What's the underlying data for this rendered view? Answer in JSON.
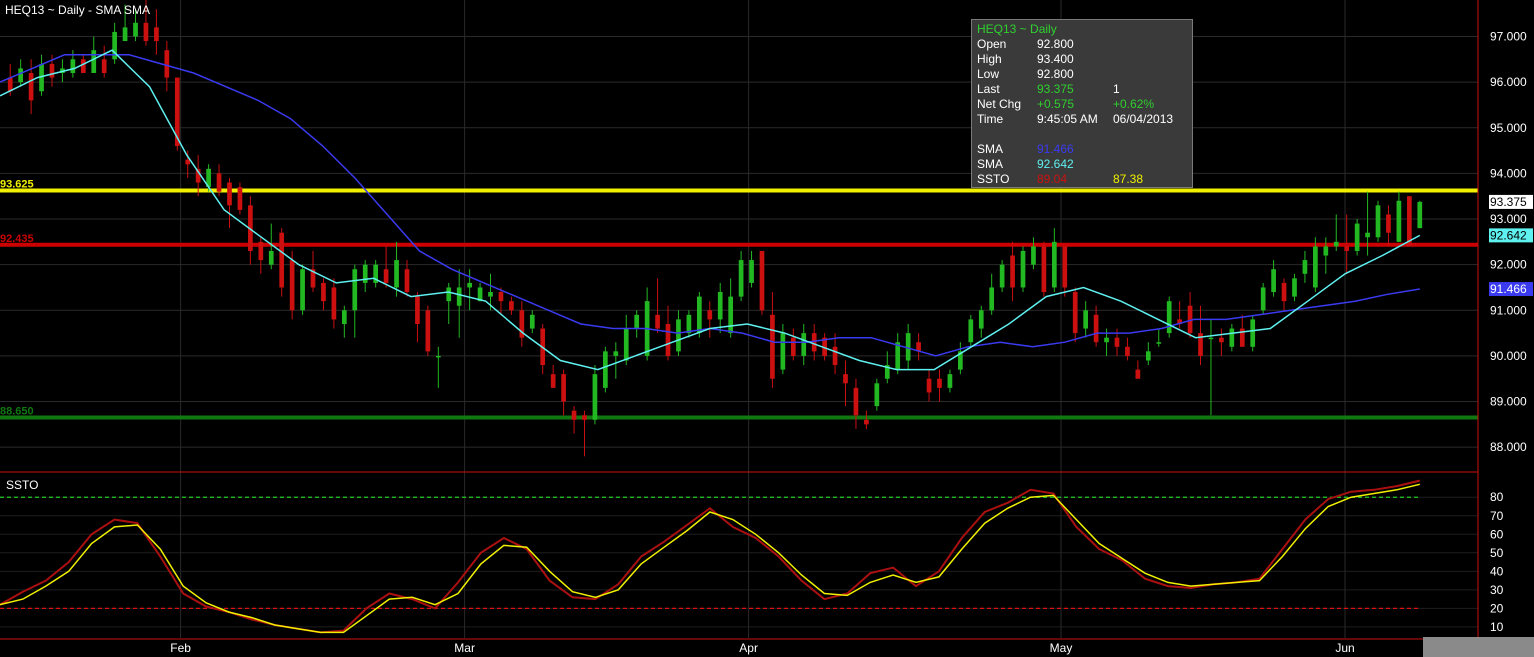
{
  "header": {
    "title": "HEQ13 ~ Daily  -  SMA SMA"
  },
  "info_panel": {
    "title": "HEQ13 ~ Daily",
    "rows": [
      {
        "label": "Open",
        "v1": "92.800",
        "v2": "",
        "c1": "#ffffff",
        "c2": "#ffffff"
      },
      {
        "label": "High",
        "v1": "93.400",
        "v2": "",
        "c1": "#ffffff",
        "c2": "#ffffff"
      },
      {
        "label": "Low",
        "v1": "92.800",
        "v2": "",
        "c1": "#ffffff",
        "c2": "#ffffff"
      },
      {
        "label": "Last",
        "v1": "93.375",
        "v2": "1",
        "c1": "#2fd02f",
        "c2": "#ffffff"
      },
      {
        "label": "Net Chg",
        "v1": "+0.575",
        "v2": "+0.62%",
        "c1": "#2fd02f",
        "c2": "#2fd02f"
      },
      {
        "label": "Time",
        "v1": "9:45:05 AM",
        "v2": "06/04/2013",
        "c1": "#ffffff",
        "c2": "#ffffff"
      },
      {
        "label": "",
        "v1": "",
        "v2": "",
        "c1": "#ffffff",
        "c2": "#ffffff"
      },
      {
        "label": "SMA",
        "v1": "91.466",
        "v2": "",
        "c1": "#3a3af0",
        "c2": "#ffffff"
      },
      {
        "label": "SMA",
        "v1": "92.642",
        "v2": "",
        "c1": "#5ff0f0",
        "c2": "#ffffff"
      },
      {
        "label": "SSTO",
        "v1": "89.04",
        "v2": "87.38",
        "c1": "#d01010",
        "c2": "#f0f000"
      }
    ]
  },
  "colors": {
    "up": "#22b822",
    "down": "#cc1010",
    "sma_slow": "#3a3af0",
    "sma_fast": "#5ff0f0",
    "ssto_k": "#aa1010",
    "ssto_d": "#f0f000"
  },
  "chart_data": {
    "type": "candlestick",
    "x_tick_labels": [
      "Feb",
      "Mar",
      "Apr",
      "May",
      "Jun"
    ],
    "x_tick_positions": [
      12,
      32,
      52,
      74,
      94
    ],
    "price_axis": {
      "ticks": [
        "88.000",
        "89.000",
        "90.000",
        "91.000",
        "92.000",
        "93.000",
        "94.000",
        "95.000",
        "96.000",
        "97.000"
      ],
      "range": [
        87.5,
        97.8
      ]
    },
    "ssto_axis": {
      "title": "SSTO",
      "ticks": [
        "10",
        "20",
        "30",
        "40",
        "50",
        "60",
        "70",
        "80"
      ],
      "range": [
        4,
        92
      ],
      "overbought": 80,
      "oversold": 20
    },
    "horizontal_lines": [
      {
        "value": 93.625,
        "label": "93.625",
        "color": "#f0f000"
      },
      {
        "value": 92.435,
        "label": "92.435",
        "color": "#cc0000"
      },
      {
        "value": 88.65,
        "label": "88.650",
        "color": "#117711"
      }
    ],
    "right_labels": [
      {
        "value": 93.375,
        "label": "93.375",
        "bg": "#ffffff",
        "fg": "#000000"
      },
      {
        "value": 92.642,
        "label": "92.642",
        "bg": "#5ff0f0",
        "fg": "#000000"
      },
      {
        "value": 91.466,
        "label": "91.466",
        "bg": "#3a3af0",
        "fg": "#ffffff"
      }
    ],
    "candles": [
      {
        "o": 96.1,
        "h": 96.4,
        "l": 95.7,
        "c": 95.8
      },
      {
        "o": 96.0,
        "h": 96.5,
        "l": 95.9,
        "c": 96.3
      },
      {
        "o": 96.2,
        "h": 96.5,
        "l": 95.3,
        "c": 95.6
      },
      {
        "o": 95.8,
        "h": 96.6,
        "l": 95.7,
        "c": 96.4
      },
      {
        "o": 96.4,
        "h": 96.6,
        "l": 95.9,
        "c": 96.1
      },
      {
        "o": 96.2,
        "h": 96.5,
        "l": 96.0,
        "c": 96.3
      },
      {
        "o": 96.2,
        "h": 96.7,
        "l": 96.1,
        "c": 96.5
      },
      {
        "o": 96.5,
        "h": 96.6,
        "l": 96.2,
        "c": 96.2
      },
      {
        "o": 96.2,
        "h": 97.0,
        "l": 96.2,
        "c": 96.7
      },
      {
        "o": 96.5,
        "h": 96.8,
        "l": 96.1,
        "c": 96.2
      },
      {
        "o": 96.5,
        "h": 97.3,
        "l": 96.4,
        "c": 97.1
      },
      {
        "o": 96.9,
        "h": 97.7,
        "l": 96.9,
        "c": 97.2
      },
      {
        "o": 97.0,
        "h": 97.6,
        "l": 96.9,
        "c": 97.3
      },
      {
        "o": 97.3,
        "h": 97.8,
        "l": 96.8,
        "c": 96.9
      },
      {
        "o": 97.2,
        "h": 97.6,
        "l": 96.6,
        "c": 96.9
      },
      {
        "o": 96.7,
        "h": 96.9,
        "l": 95.8,
        "c": 96.1
      },
      {
        "o": 96.1,
        "h": 96.1,
        "l": 94.5,
        "c": 94.6
      },
      {
        "o": 94.3,
        "h": 94.5,
        "l": 93.9,
        "c": 94.2
      },
      {
        "o": 94.1,
        "h": 94.4,
        "l": 93.5,
        "c": 93.8
      },
      {
        "o": 93.7,
        "h": 94.2,
        "l": 93.6,
        "c": 94.1
      },
      {
        "o": 94.0,
        "h": 94.2,
        "l": 93.5,
        "c": 93.6
      },
      {
        "o": 93.8,
        "h": 93.9,
        "l": 92.8,
        "c": 93.3
      },
      {
        "o": 93.7,
        "h": 93.8,
        "l": 93.1,
        "c": 93.2
      },
      {
        "o": 93.3,
        "h": 93.5,
        "l": 92.0,
        "c": 92.3
      },
      {
        "o": 92.5,
        "h": 92.6,
        "l": 91.8,
        "c": 92.1
      },
      {
        "o": 92.0,
        "h": 92.9,
        "l": 91.9,
        "c": 92.3
      },
      {
        "o": 92.7,
        "h": 92.8,
        "l": 91.3,
        "c": 91.5
      },
      {
        "o": 92.1,
        "h": 92.3,
        "l": 90.8,
        "c": 91.0
      },
      {
        "o": 91.0,
        "h": 92.0,
        "l": 90.9,
        "c": 91.9
      },
      {
        "o": 91.9,
        "h": 92.3,
        "l": 91.4,
        "c": 91.5
      },
      {
        "o": 91.6,
        "h": 91.7,
        "l": 91.0,
        "c": 91.2
      },
      {
        "o": 91.5,
        "h": 91.7,
        "l": 90.6,
        "c": 90.8
      },
      {
        "o": 90.7,
        "h": 91.1,
        "l": 90.4,
        "c": 91.0
      },
      {
        "o": 91.0,
        "h": 92.0,
        "l": 90.4,
        "c": 91.9
      },
      {
        "o": 91.6,
        "h": 92.1,
        "l": 91.4,
        "c": 92.0
      },
      {
        "o": 91.6,
        "h": 92.1,
        "l": 91.5,
        "c": 92.0
      },
      {
        "o": 91.9,
        "h": 92.4,
        "l": 91.5,
        "c": 91.6
      },
      {
        "o": 91.5,
        "h": 92.5,
        "l": 91.3,
        "c": 92.1
      },
      {
        "o": 91.9,
        "h": 92.1,
        "l": 91.3,
        "c": 91.4
      },
      {
        "o": 91.3,
        "h": 91.4,
        "l": 90.3,
        "c": 90.7
      },
      {
        "o": 91.0,
        "h": 91.1,
        "l": 90.0,
        "c": 90.1
      },
      {
        "o": 90.0,
        "h": 90.2,
        "l": 89.3,
        "c": 90.0
      },
      {
        "o": 91.2,
        "h": 91.6,
        "l": 90.7,
        "c": 91.5
      },
      {
        "o": 91.1,
        "h": 91.9,
        "l": 90.4,
        "c": 91.5
      },
      {
        "o": 91.5,
        "h": 91.9,
        "l": 91.0,
        "c": 91.6
      },
      {
        "o": 91.2,
        "h": 91.6,
        "l": 91.2,
        "c": 91.5
      },
      {
        "o": 91.3,
        "h": 91.8,
        "l": 91.0,
        "c": 91.4
      },
      {
        "o": 91.4,
        "h": 91.5,
        "l": 90.9,
        "c": 91.2
      },
      {
        "o": 91.2,
        "h": 91.3,
        "l": 90.9,
        "c": 91.0
      },
      {
        "o": 91.0,
        "h": 91.2,
        "l": 90.2,
        "c": 90.4
      },
      {
        "o": 90.6,
        "h": 91.0,
        "l": 90.5,
        "c": 90.9
      },
      {
        "o": 90.6,
        "h": 90.7,
        "l": 89.6,
        "c": 89.8
      },
      {
        "o": 89.6,
        "h": 89.8,
        "l": 89.3,
        "c": 89.3
      },
      {
        "o": 89.6,
        "h": 89.7,
        "l": 88.7,
        "c": 89.0
      },
      {
        "o": 88.8,
        "h": 88.9,
        "l": 88.3,
        "c": 88.6
      },
      {
        "o": 88.7,
        "h": 88.8,
        "l": 87.8,
        "c": 88.6
      },
      {
        "o": 88.6,
        "h": 89.8,
        "l": 88.5,
        "c": 89.6
      },
      {
        "o": 89.3,
        "h": 90.2,
        "l": 89.2,
        "c": 90.1
      },
      {
        "o": 90.0,
        "h": 90.3,
        "l": 89.5,
        "c": 90.1
      },
      {
        "o": 89.9,
        "h": 90.9,
        "l": 89.8,
        "c": 90.6
      },
      {
        "o": 90.6,
        "h": 91.0,
        "l": 90.4,
        "c": 90.9
      },
      {
        "o": 90.0,
        "h": 91.5,
        "l": 89.9,
        "c": 91.2
      },
      {
        "o": 90.9,
        "h": 91.7,
        "l": 90.5,
        "c": 90.6
      },
      {
        "o": 90.7,
        "h": 91.1,
        "l": 89.9,
        "c": 90.0
      },
      {
        "o": 90.1,
        "h": 91.0,
        "l": 90.0,
        "c": 90.8
      },
      {
        "o": 90.5,
        "h": 91.0,
        "l": 90.4,
        "c": 90.9
      },
      {
        "o": 90.5,
        "h": 91.4,
        "l": 90.4,
        "c": 91.3
      },
      {
        "o": 91.0,
        "h": 91.2,
        "l": 90.4,
        "c": 90.8
      },
      {
        "o": 90.8,
        "h": 91.6,
        "l": 90.5,
        "c": 91.4
      },
      {
        "o": 90.5,
        "h": 91.7,
        "l": 90.4,
        "c": 91.3
      },
      {
        "o": 91.3,
        "h": 92.3,
        "l": 91.2,
        "c": 92.1
      },
      {
        "o": 91.6,
        "h": 92.3,
        "l": 91.5,
        "c": 92.1
      },
      {
        "o": 92.3,
        "h": 92.3,
        "l": 90.9,
        "c": 91.0
      },
      {
        "o": 90.9,
        "h": 91.4,
        "l": 89.3,
        "c": 89.5
      },
      {
        "o": 89.7,
        "h": 90.7,
        "l": 89.6,
        "c": 90.5
      },
      {
        "o": 90.4,
        "h": 90.6,
        "l": 89.9,
        "c": 90.0
      },
      {
        "o": 90.0,
        "h": 90.7,
        "l": 89.8,
        "c": 90.5
      },
      {
        "o": 90.5,
        "h": 90.7,
        "l": 89.9,
        "c": 90.1
      },
      {
        "o": 90.4,
        "h": 90.5,
        "l": 89.9,
        "c": 90.0
      },
      {
        "o": 90.2,
        "h": 90.5,
        "l": 89.6,
        "c": 89.8
      },
      {
        "o": 89.6,
        "h": 89.9,
        "l": 88.9,
        "c": 89.4
      },
      {
        "o": 89.3,
        "h": 89.5,
        "l": 88.4,
        "c": 88.7
      },
      {
        "o": 88.6,
        "h": 88.8,
        "l": 88.4,
        "c": 88.5
      },
      {
        "o": 88.9,
        "h": 89.5,
        "l": 88.8,
        "c": 89.4
      },
      {
        "o": 89.5,
        "h": 90.1,
        "l": 89.4,
        "c": 89.8
      },
      {
        "o": 89.7,
        "h": 90.5,
        "l": 89.6,
        "c": 90.3
      },
      {
        "o": 89.9,
        "h": 90.7,
        "l": 89.7,
        "c": 90.5
      },
      {
        "o": 90.3,
        "h": 90.5,
        "l": 89.9,
        "c": 90.1
      },
      {
        "o": 89.5,
        "h": 89.7,
        "l": 89.0,
        "c": 89.2
      },
      {
        "o": 89.5,
        "h": 89.7,
        "l": 89.0,
        "c": 89.3
      },
      {
        "o": 89.3,
        "h": 89.7,
        "l": 89.2,
        "c": 89.6
      },
      {
        "o": 89.7,
        "h": 90.3,
        "l": 89.6,
        "c": 90.1
      },
      {
        "o": 90.3,
        "h": 90.9,
        "l": 90.2,
        "c": 90.8
      },
      {
        "o": 90.6,
        "h": 91.1,
        "l": 90.4,
        "c": 91.0
      },
      {
        "o": 91.0,
        "h": 91.8,
        "l": 90.9,
        "c": 91.5
      },
      {
        "o": 91.5,
        "h": 92.1,
        "l": 91.4,
        "c": 92.0
      },
      {
        "o": 92.2,
        "h": 92.5,
        "l": 91.2,
        "c": 91.5
      },
      {
        "o": 91.5,
        "h": 92.4,
        "l": 91.4,
        "c": 92.3
      },
      {
        "o": 92.0,
        "h": 92.6,
        "l": 91.9,
        "c": 92.4
      },
      {
        "o": 92.4,
        "h": 92.5,
        "l": 91.3,
        "c": 91.4
      },
      {
        "o": 91.5,
        "h": 92.8,
        "l": 91.4,
        "c": 92.5
      },
      {
        "o": 92.4,
        "h": 92.4,
        "l": 91.3,
        "c": 91.5
      },
      {
        "o": 91.4,
        "h": 91.5,
        "l": 90.3,
        "c": 90.5
      },
      {
        "o": 90.6,
        "h": 91.2,
        "l": 90.4,
        "c": 91.0
      },
      {
        "o": 90.9,
        "h": 91.1,
        "l": 90.2,
        "c": 90.3
      },
      {
        "o": 90.3,
        "h": 90.6,
        "l": 90.0,
        "c": 90.4
      },
      {
        "o": 90.4,
        "h": 90.6,
        "l": 90.0,
        "c": 90.2
      },
      {
        "o": 90.2,
        "h": 90.4,
        "l": 89.9,
        "c": 90.0
      },
      {
        "o": 89.7,
        "h": 89.9,
        "l": 89.5,
        "c": 89.5
      },
      {
        "o": 89.9,
        "h": 90.3,
        "l": 89.8,
        "c": 90.1
      },
      {
        "o": 90.3,
        "h": 90.6,
        "l": 90.2,
        "c": 90.3
      },
      {
        "o": 90.5,
        "h": 91.3,
        "l": 90.4,
        "c": 91.2
      },
      {
        "o": 90.8,
        "h": 91.2,
        "l": 90.6,
        "c": 90.7
      },
      {
        "o": 91.1,
        "h": 91.4,
        "l": 90.4,
        "c": 90.5
      },
      {
        "o": 90.5,
        "h": 91.1,
        "l": 89.8,
        "c": 90.0
      },
      {
        "o": 90.4,
        "h": 90.8,
        "l": 88.7,
        "c": 90.4
      },
      {
        "o": 90.4,
        "h": 90.6,
        "l": 90.0,
        "c": 90.3
      },
      {
        "o": 90.2,
        "h": 90.7,
        "l": 90.1,
        "c": 90.6
      },
      {
        "o": 90.6,
        "h": 90.9,
        "l": 90.2,
        "c": 90.2
      },
      {
        "o": 90.2,
        "h": 90.9,
        "l": 90.1,
        "c": 90.8
      },
      {
        "o": 91.0,
        "h": 91.6,
        "l": 90.9,
        "c": 91.5
      },
      {
        "o": 91.4,
        "h": 92.1,
        "l": 91.3,
        "c": 91.9
      },
      {
        "o": 91.6,
        "h": 91.7,
        "l": 91.0,
        "c": 91.2
      },
      {
        "o": 91.3,
        "h": 91.8,
        "l": 91.2,
        "c": 91.7
      },
      {
        "o": 91.8,
        "h": 92.3,
        "l": 91.6,
        "c": 92.1
      },
      {
        "o": 91.5,
        "h": 92.6,
        "l": 91.4,
        "c": 92.4
      },
      {
        "o": 92.2,
        "h": 92.6,
        "l": 91.8,
        "c": 92.4
      },
      {
        "o": 92.4,
        "h": 93.1,
        "l": 92.3,
        "c": 92.5
      },
      {
        "o": 92.4,
        "h": 93.1,
        "l": 91.8,
        "c": 92.3
      },
      {
        "o": 92.3,
        "h": 93.0,
        "l": 92.2,
        "c": 92.9
      },
      {
        "o": 92.6,
        "h": 93.6,
        "l": 92.2,
        "c": 92.7
      },
      {
        "o": 92.6,
        "h": 93.4,
        "l": 92.5,
        "c": 93.3
      },
      {
        "o": 93.1,
        "h": 93.3,
        "l": 92.4,
        "c": 92.7
      },
      {
        "o": 92.5,
        "h": 93.6,
        "l": 92.5,
        "c": 93.4
      },
      {
        "o": 93.5,
        "h": 93.5,
        "l": 92.4,
        "c": 92.4
      },
      {
        "o": 92.8,
        "h": 93.4,
        "l": 92.8,
        "c": 93.375
      }
    ],
    "sma_slow": [
      96.0,
      96.3,
      96.6,
      96.6,
      96.6,
      96.4,
      96.2,
      95.9,
      95.6,
      95.2,
      94.6,
      93.9,
      93.1,
      92.3,
      91.9,
      91.6,
      91.3,
      91.0,
      90.7,
      90.6,
      90.6,
      90.5,
      90.6,
      90.5,
      90.3,
      90.3,
      90.4,
      90.4,
      90.2,
      90.0,
      90.2,
      90.3,
      90.2,
      90.3,
      90.5,
      90.5,
      90.6,
      90.8,
      90.8,
      90.9,
      91.0,
      91.1,
      91.2,
      91.35,
      91.466
    ],
    "sma_fast": [
      95.7,
      96.1,
      96.3,
      96.7,
      95.9,
      94.4,
      93.2,
      92.6,
      92.0,
      91.6,
      91.7,
      91.3,
      91.4,
      91.2,
      90.5,
      89.9,
      89.7,
      90.0,
      90.3,
      90.6,
      90.7,
      90.5,
      90.2,
      89.9,
      89.7,
      89.7,
      90.2,
      90.7,
      91.3,
      91.5,
      91.2,
      90.8,
      90.4,
      90.5,
      90.6,
      91.2,
      91.8,
      92.2,
      92.642
    ],
    "ssto_k": [
      22,
      29,
      35,
      45,
      60,
      68,
      66,
      48,
      28,
      21,
      18,
      14,
      11,
      9,
      7,
      8,
      20,
      28,
      25,
      20,
      34,
      50,
      58,
      52,
      35,
      26,
      25,
      33,
      48,
      56,
      65,
      74,
      64,
      58,
      48,
      35,
      25,
      28,
      39,
      42,
      32,
      40,
      58,
      72,
      77,
      84,
      82,
      64,
      52,
      46,
      36,
      32,
      31,
      33,
      34,
      36,
      52,
      68,
      79,
      83,
      84,
      86,
      89
    ],
    "ssto_d": [
      22,
      25,
      32,
      40,
      55,
      64,
      65,
      52,
      32,
      23,
      18,
      15,
      11,
      9,
      7,
      7,
      16,
      25,
      26,
      22,
      28,
      44,
      54,
      53,
      40,
      29,
      26,
      30,
      44,
      53,
      62,
      72,
      68,
      60,
      50,
      38,
      28,
      27,
      34,
      38,
      34,
      37,
      52,
      66,
      74,
      80,
      81,
      68,
      55,
      47,
      39,
      34,
      32,
      33,
      34,
      35,
      48,
      63,
      75,
      80,
      82,
      84,
      87
    ]
  }
}
